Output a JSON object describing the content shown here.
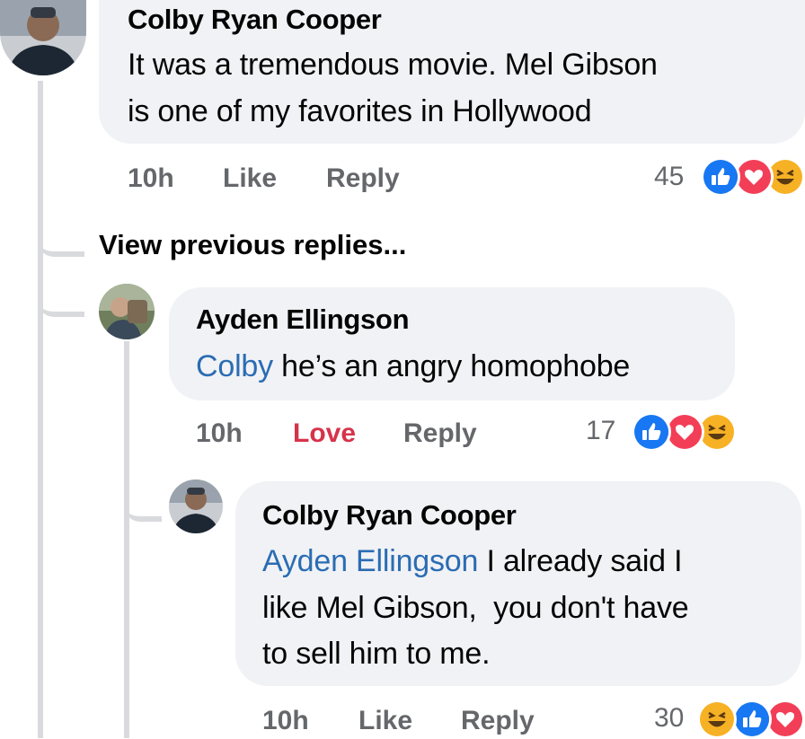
{
  "thread": {
    "top_comment": {
      "author": "Colby Ryan Cooper",
      "text_lines": [
        "It was a tremendous movie. Mel Gibson",
        "is one of my favorites in Hollywood"
      ],
      "time": "10h",
      "like_label": "Like",
      "reply_label": "Reply",
      "reaction_count": "45",
      "reactions": [
        "like-icon",
        "love-icon",
        "haha-icon"
      ]
    },
    "view_previous": "View previous replies...",
    "reply1": {
      "author": "Ayden Ellingson",
      "mention": "Colby",
      "text": " he’s an angry homophobe",
      "time": "10h",
      "like_label": "Love",
      "reply_label": "Reply",
      "reaction_count": "17",
      "reactions": [
        "like-icon",
        "love-icon",
        "haha-icon"
      ]
    },
    "reply2": {
      "author": "Colby Ryan Cooper",
      "mention": "Ayden Ellingson",
      "line1_rest": " I already said I",
      "line2": "like Mel Gibson,  you don't have",
      "line3": "to sell him to me.",
      "time": "10h",
      "like_label": "Like",
      "reply_label": "Reply",
      "reaction_count": "30",
      "reactions": [
        "haha-icon",
        "like-icon",
        "love-icon"
      ]
    }
  },
  "colors": {
    "bubble": "#f0f2f5",
    "mention": "#2b6cb3",
    "meta": "#65676b",
    "love": "#d6334a",
    "like_blue": "#1877f2",
    "love_red": "#f33e58",
    "haha_yellow": "#f7b125"
  }
}
